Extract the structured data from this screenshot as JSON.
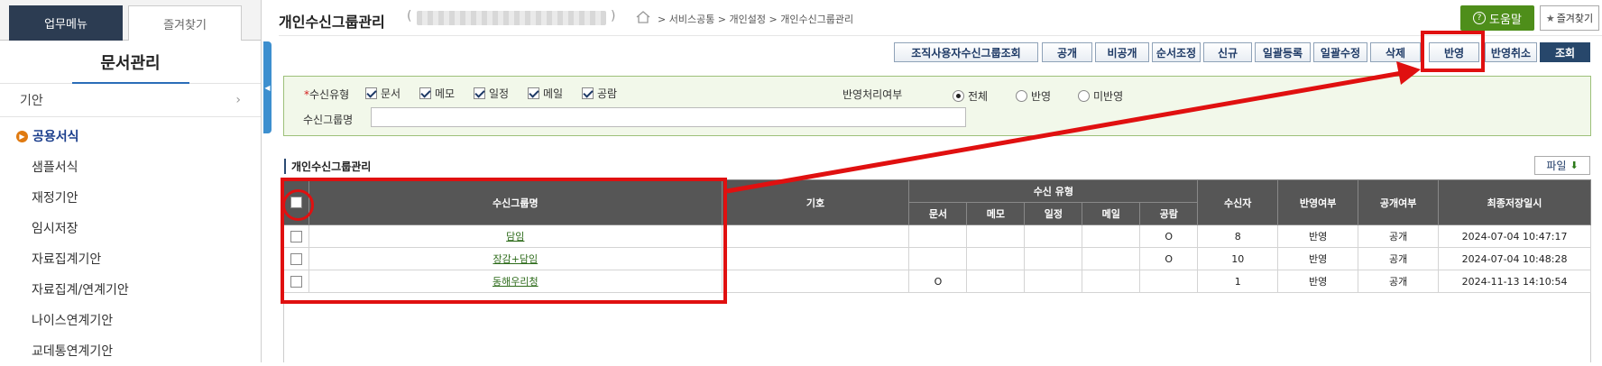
{
  "sidebar": {
    "tabs": [
      {
        "label": "업무메뉴"
      },
      {
        "label": "즐겨찾기"
      }
    ],
    "title": "문서관리",
    "items": [
      {
        "label": "기안"
      },
      {
        "label": "공용서식"
      },
      {
        "label": "샘플서식"
      },
      {
        "label": "재정기안"
      },
      {
        "label": "임시저장"
      },
      {
        "label": "자료집계기안"
      },
      {
        "label": "자료집계/연계기안"
      },
      {
        "label": "나이스연계기안"
      },
      {
        "label": "교데통연계기안"
      }
    ]
  },
  "header": {
    "title": "개인수신그룹관리",
    "paren_open": "(",
    "paren_close": ")",
    "breadcrumb": "> 서비스공통 > 개인설정 > 개인수신그룹관리",
    "help": "도움말",
    "favorite": "즐겨찾기"
  },
  "toolbar": [
    {
      "label": "조직사용자수신그룹조회"
    },
    {
      "label": "공개"
    },
    {
      "label": "비공개"
    },
    {
      "label": "순서조정"
    },
    {
      "label": "신규"
    },
    {
      "label": "일괄등록"
    },
    {
      "label": "일괄수정"
    },
    {
      "label": "삭제"
    },
    {
      "label": "반영"
    },
    {
      "label": "반영취소"
    },
    {
      "label": "조회"
    }
  ],
  "search": {
    "required_mark": "*",
    "type_label": "수신유형",
    "types": [
      "문서",
      "메모",
      "일정",
      "메일",
      "공람"
    ],
    "reflect_label": "반영처리여부",
    "reflect_options": [
      "전체",
      "반영",
      "미반영"
    ],
    "group_name_label": "수신그룹명",
    "group_name_value": ""
  },
  "section_title": "개인수신그룹관리",
  "file_button": "파일",
  "table": {
    "headers": {
      "name": "수신그룹명",
      "code": "기호",
      "type_group": "수신 유형",
      "types": [
        "문서",
        "메모",
        "일정",
        "메일",
        "공람"
      ],
      "receivers": "수신자",
      "reflected": "반영여부",
      "public": "공개여부",
      "saved": "최종저장일시"
    },
    "rows": [
      {
        "name": "담임",
        "code": "",
        "doc": "",
        "memo": "",
        "sched": "",
        "mail": "",
        "view": "O",
        "receivers": "8",
        "reflected": "반영",
        "public": "공개",
        "saved": "2024-07-04 10:47:17"
      },
      {
        "name": "장감+담임",
        "code": "",
        "doc": "",
        "memo": "",
        "sched": "",
        "mail": "",
        "view": "O",
        "receivers": "10",
        "reflected": "반영",
        "public": "공개",
        "saved": "2024-07-04 10:48:28"
      },
      {
        "name": "동해우리청",
        "code": "",
        "doc": "O",
        "memo": "",
        "sched": "",
        "mail": "",
        "view": "",
        "receivers": "1",
        "reflected": "반영",
        "public": "공개",
        "saved": "2024-11-13 14:10:54"
      }
    ]
  },
  "colors": {
    "highlight": "#e01010",
    "nav_dark": "#2c3c52",
    "help_green": "#4e8e1a"
  }
}
